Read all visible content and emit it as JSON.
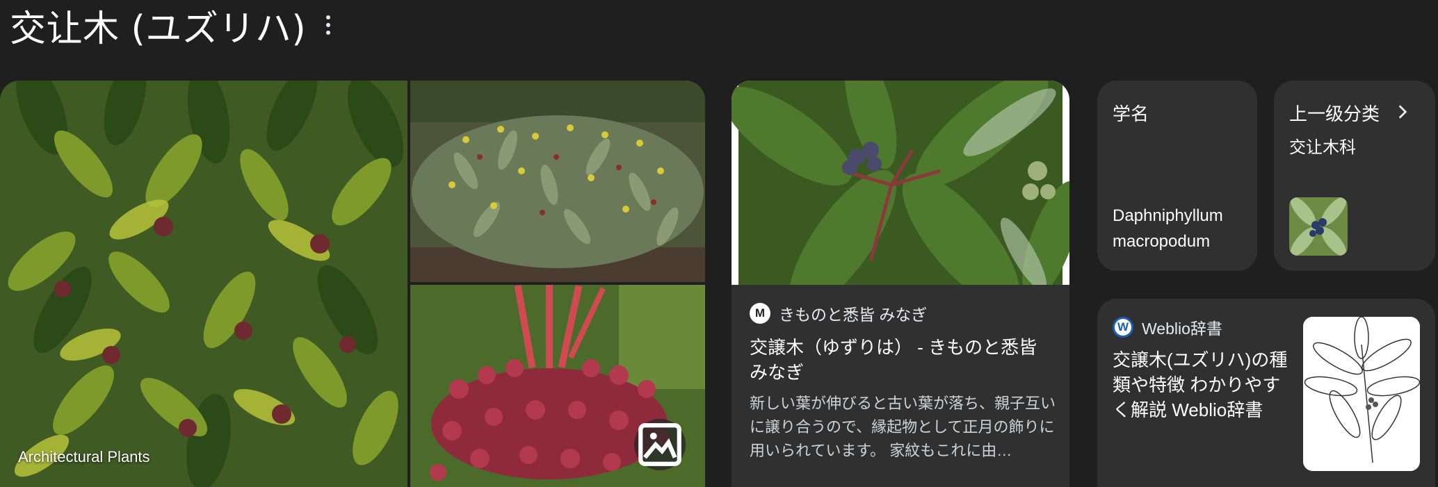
{
  "header": {
    "title": "交让木 (ユズリハ)",
    "more_icon": "more-vert-icon"
  },
  "gallery": {
    "caption": "Architectural Plants",
    "image_search_icon": "image-search-icon"
  },
  "results": {
    "kimono": {
      "source_logo_letter": "M",
      "source_name": "きものと悉皆 みなぎ",
      "title": "交譲木（ゆずりは） - きものと悉皆 みなぎ",
      "snippet": "新しい葉が伸びると古い葉が落ち、親子互いに譲り合うので、縁起物として正月の飾りに用いられています。 家紋もこれに由…"
    },
    "weblio": {
      "source_logo_letter": "W",
      "source_name": "Weblio辞書",
      "title": "交譲木(ユズリハ)の種類や特徴 わかりやすく解説 Weblio辞書"
    }
  },
  "facts": {
    "scientific_name": {
      "label": "学名",
      "value": "Daphniphyllum macropodum"
    },
    "parent_taxon": {
      "label": "上一级分类",
      "value": "交让木科",
      "arrow_icon": "chevron-right-icon"
    }
  },
  "colors": {
    "background": "#1f1f1f",
    "card": "#303030",
    "weblio_blue": "#1a5fb4"
  }
}
